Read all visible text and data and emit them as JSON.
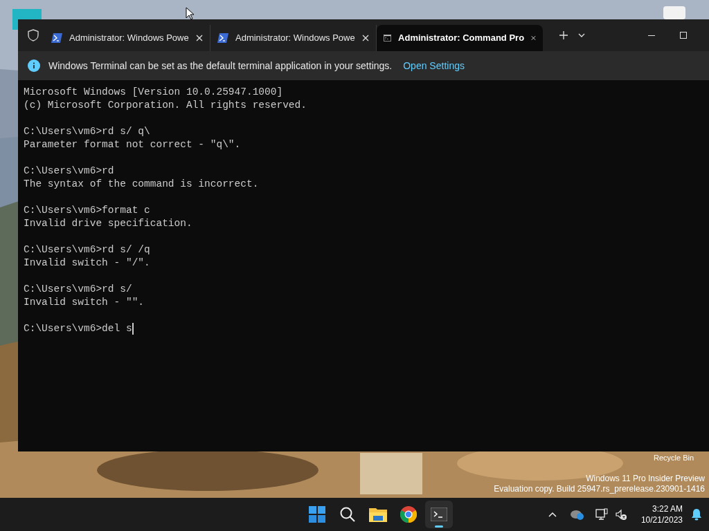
{
  "window": {
    "tabs": [
      {
        "kind": "powershell",
        "title": "Administrator: Windows Powe",
        "selected": false
      },
      {
        "kind": "powershell",
        "title": "Administrator: Windows Powe",
        "selected": false
      },
      {
        "kind": "cmd",
        "title": "Administrator: Command Pro",
        "selected": true
      }
    ],
    "infobar": {
      "message": "Windows Terminal can be set as the default terminal application in your settings.",
      "link": "Open Settings"
    },
    "terminal_blocks": [
      [
        "Microsoft Windows [Version 10.0.25947.1000]",
        "(c) Microsoft Corporation. All rights reserved."
      ],
      [
        "C:\\Users\\vm6>rd s/ q\\",
        "Parameter format not correct - \"q\\\"."
      ],
      [
        "C:\\Users\\vm6>rd",
        "The syntax of the command is incorrect."
      ],
      [
        "C:\\Users\\vm6>format c",
        "Invalid drive specification."
      ],
      [
        "C:\\Users\\vm6>rd s/ /q",
        "Invalid switch - \"/\"."
      ],
      [
        "C:\\Users\\vm6>rd s/",
        "Invalid switch - \"\"."
      ],
      [
        "C:\\Users\\vm6>del s"
      ]
    ]
  },
  "desktop": {
    "recycle_bin": "Recycle Bin",
    "watermark": [
      "Windows 11 Pro Insider Preview",
      "Evaluation copy. Build 25947.rs_prerelease.230901-1416"
    ]
  },
  "taskbar": {
    "clock_time": "3:22 AM",
    "clock_date": "10/21/2023"
  }
}
